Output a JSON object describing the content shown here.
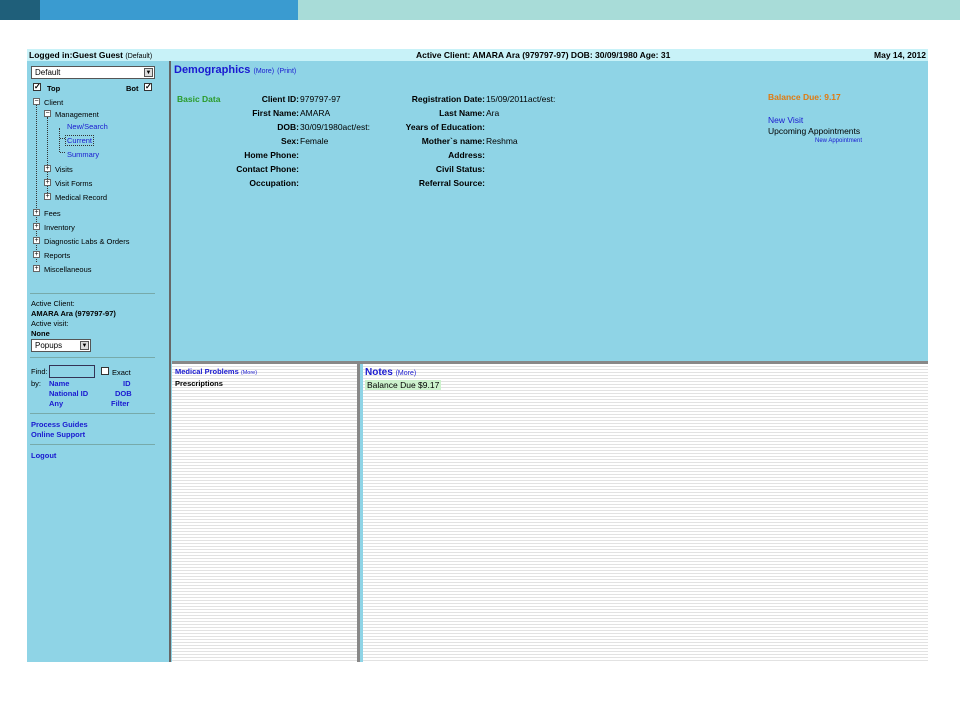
{
  "topbar": {
    "login_label": "Logged in:Guest Guest",
    "login_suffix": "(Default)",
    "active_client": "Active Client: AMARA Ara (979797-97) DOB: 30/09/1980 Age: 31",
    "date": "May 14, 2012"
  },
  "sidebar": {
    "profile_select": "Default",
    "top_label": "Top",
    "bot_label": "Bot",
    "top_checked": true,
    "bot_checked": true,
    "tree": {
      "client": "Client",
      "management": "Management",
      "new_search": "New/Search",
      "current": "Current",
      "summary": "Summary",
      "visits": "Visits",
      "visit_forms": "Visit Forms",
      "medical_record": "Medical Record",
      "fees": "Fees",
      "inventory": "Inventory",
      "diagnostic": "Diagnostic Labs & Orders",
      "reports": "Reports",
      "misc": "Miscellaneous"
    },
    "active_client_label": "Active Client:",
    "active_client_value": "AMARA Ara (979797-97)",
    "active_visit_label": "Active visit:",
    "active_visit_value": "None",
    "popups_select": "Popups",
    "find": {
      "label": "Find:",
      "exact": "Exact",
      "by": "by:",
      "name": "Name",
      "id": "ID",
      "national_id": "National ID",
      "dob": "DOB",
      "any": "Any",
      "filter": "Filter"
    },
    "process_guides": "Process Guides",
    "online_support": "Online Support",
    "logout": "Logout"
  },
  "demographics": {
    "title": "Demographics",
    "more": "(More)",
    "print": "(Print)",
    "basic_data": "Basic Data",
    "fields_left": [
      {
        "label": "Client ID:",
        "value": "979797-97"
      },
      {
        "label": "First Name:",
        "value": "AMARA"
      },
      {
        "label": "DOB:",
        "value": "30/09/1980act/est:"
      },
      {
        "label": "Sex:",
        "value": "Female"
      },
      {
        "label": "Home Phone:",
        "value": ""
      },
      {
        "label": "Contact Phone:",
        "value": ""
      },
      {
        "label": "Occupation:",
        "value": ""
      }
    ],
    "fields_right": [
      {
        "label": "Registration Date:",
        "value": "15/09/2011act/est:"
      },
      {
        "label": "Last Name:",
        "value": "Ara"
      },
      {
        "label": "Years of Education:",
        "value": ""
      },
      {
        "label": "Mother`s name:",
        "value": "Reshma"
      },
      {
        "label": "Address:",
        "value": ""
      },
      {
        "label": "Civil Status:",
        "value": ""
      },
      {
        "label": "Referral Source:",
        "value": ""
      }
    ],
    "balance_due": "Balance Due: 9.17",
    "new_visit": "New Visit",
    "upcoming": "Upcoming Appointments",
    "new_appointment": "New Appointment"
  },
  "medical": {
    "title": "Medical Problems",
    "more": "(More)",
    "prescriptions": "Prescriptions"
  },
  "notes": {
    "title": "Notes",
    "more": "(More)",
    "balance_label": "Balance Due",
    "balance_value": "$9.17"
  },
  "colors": {
    "app_bg": "#8fd4e6",
    "topbar_bg": "#c8f2f8",
    "link": "#1a1ad0",
    "basic_data": "#2a9a2a",
    "balance": "#e07a10"
  }
}
